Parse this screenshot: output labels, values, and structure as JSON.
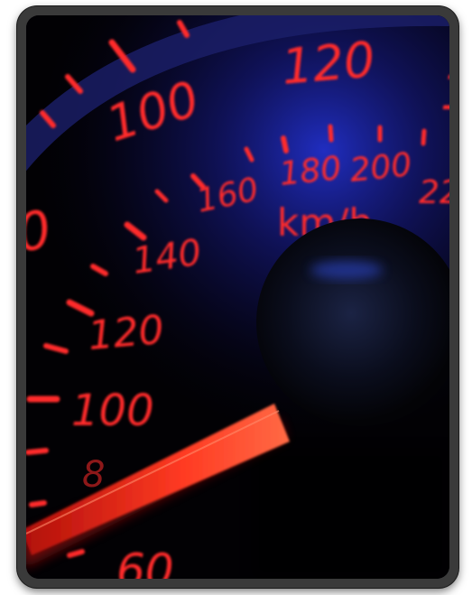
{
  "image": {
    "subject": "car-speedometer",
    "colors": {
      "frame": "#3a3a3a",
      "background": "#020104",
      "glow": "#2a3cff",
      "markings": "#ff2b2b",
      "needle": "#ff3a22"
    },
    "outer_scale": {
      "labels": [
        "120",
        "140",
        "160",
        "180",
        "200",
        "22",
        "km/h"
      ]
    },
    "inner_scale": {
      "labels": [
        "0",
        "100",
        "120",
        "140",
        "100",
        "60"
      ]
    }
  }
}
